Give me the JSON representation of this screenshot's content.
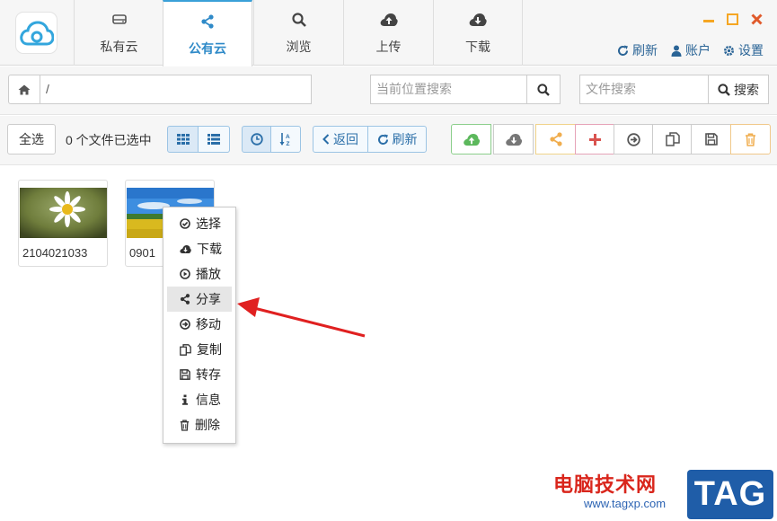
{
  "tabs": [
    {
      "label": "私有云",
      "icon": "hdd-icon"
    },
    {
      "label": "公有云",
      "icon": "share-icon",
      "active": true
    },
    {
      "label": "浏览",
      "icon": "search-icon"
    },
    {
      "label": "上传",
      "icon": "cloud-upload-icon"
    },
    {
      "label": "下载",
      "icon": "cloud-download-icon"
    }
  ],
  "header": {
    "refresh": "刷新",
    "account": "账户",
    "settings": "设置"
  },
  "path": {
    "value": "/"
  },
  "search": {
    "location_placeholder": "当前位置搜索",
    "file_placeholder": "文件搜索",
    "file_button": "搜索"
  },
  "toolbar": {
    "select_all": "全选",
    "selected_count": "0 个文件已选中",
    "back": "返回",
    "refresh": "刷新"
  },
  "actions": [
    {
      "icon": "cloud-upload-icon",
      "color": "#5cb85c"
    },
    {
      "icon": "cloud-download-icon",
      "color": "#777777"
    },
    {
      "icon": "share-icon",
      "color": "#f0ad4e"
    },
    {
      "icon": "plus-icon",
      "color": "#d9534f"
    },
    {
      "icon": "arrow-circle-right-icon",
      "color": "#555555"
    },
    {
      "icon": "copy-icon",
      "color": "#555555"
    },
    {
      "icon": "save-icon",
      "color": "#555555"
    },
    {
      "icon": "trash-icon",
      "color": "#f0ad4e"
    }
  ],
  "files": [
    {
      "name": "2104021033"
    },
    {
      "name": "0901"
    }
  ],
  "context_menu": [
    {
      "label": "选择",
      "icon": "check-circle-icon"
    },
    {
      "label": "下载",
      "icon": "cloud-download-icon"
    },
    {
      "label": "播放",
      "icon": "play-circle-icon"
    },
    {
      "label": "分享",
      "icon": "share-icon",
      "highlighted": true
    },
    {
      "label": "移动",
      "icon": "arrow-circle-right-icon"
    },
    {
      "label": "复制",
      "icon": "copy-icon"
    },
    {
      "label": "转存",
      "icon": "save-icon"
    },
    {
      "label": "信息",
      "icon": "info-icon"
    },
    {
      "label": "删除",
      "icon": "trash-icon"
    }
  ],
  "watermark": {
    "site_name": "电脑技术网",
    "url": "www.tagxp.com",
    "tag": "TAG"
  },
  "colors": {
    "accent": "#2f8ac8",
    "arrow": "#e02020",
    "close": "#e05a2b",
    "minimize": "#f5a623"
  }
}
